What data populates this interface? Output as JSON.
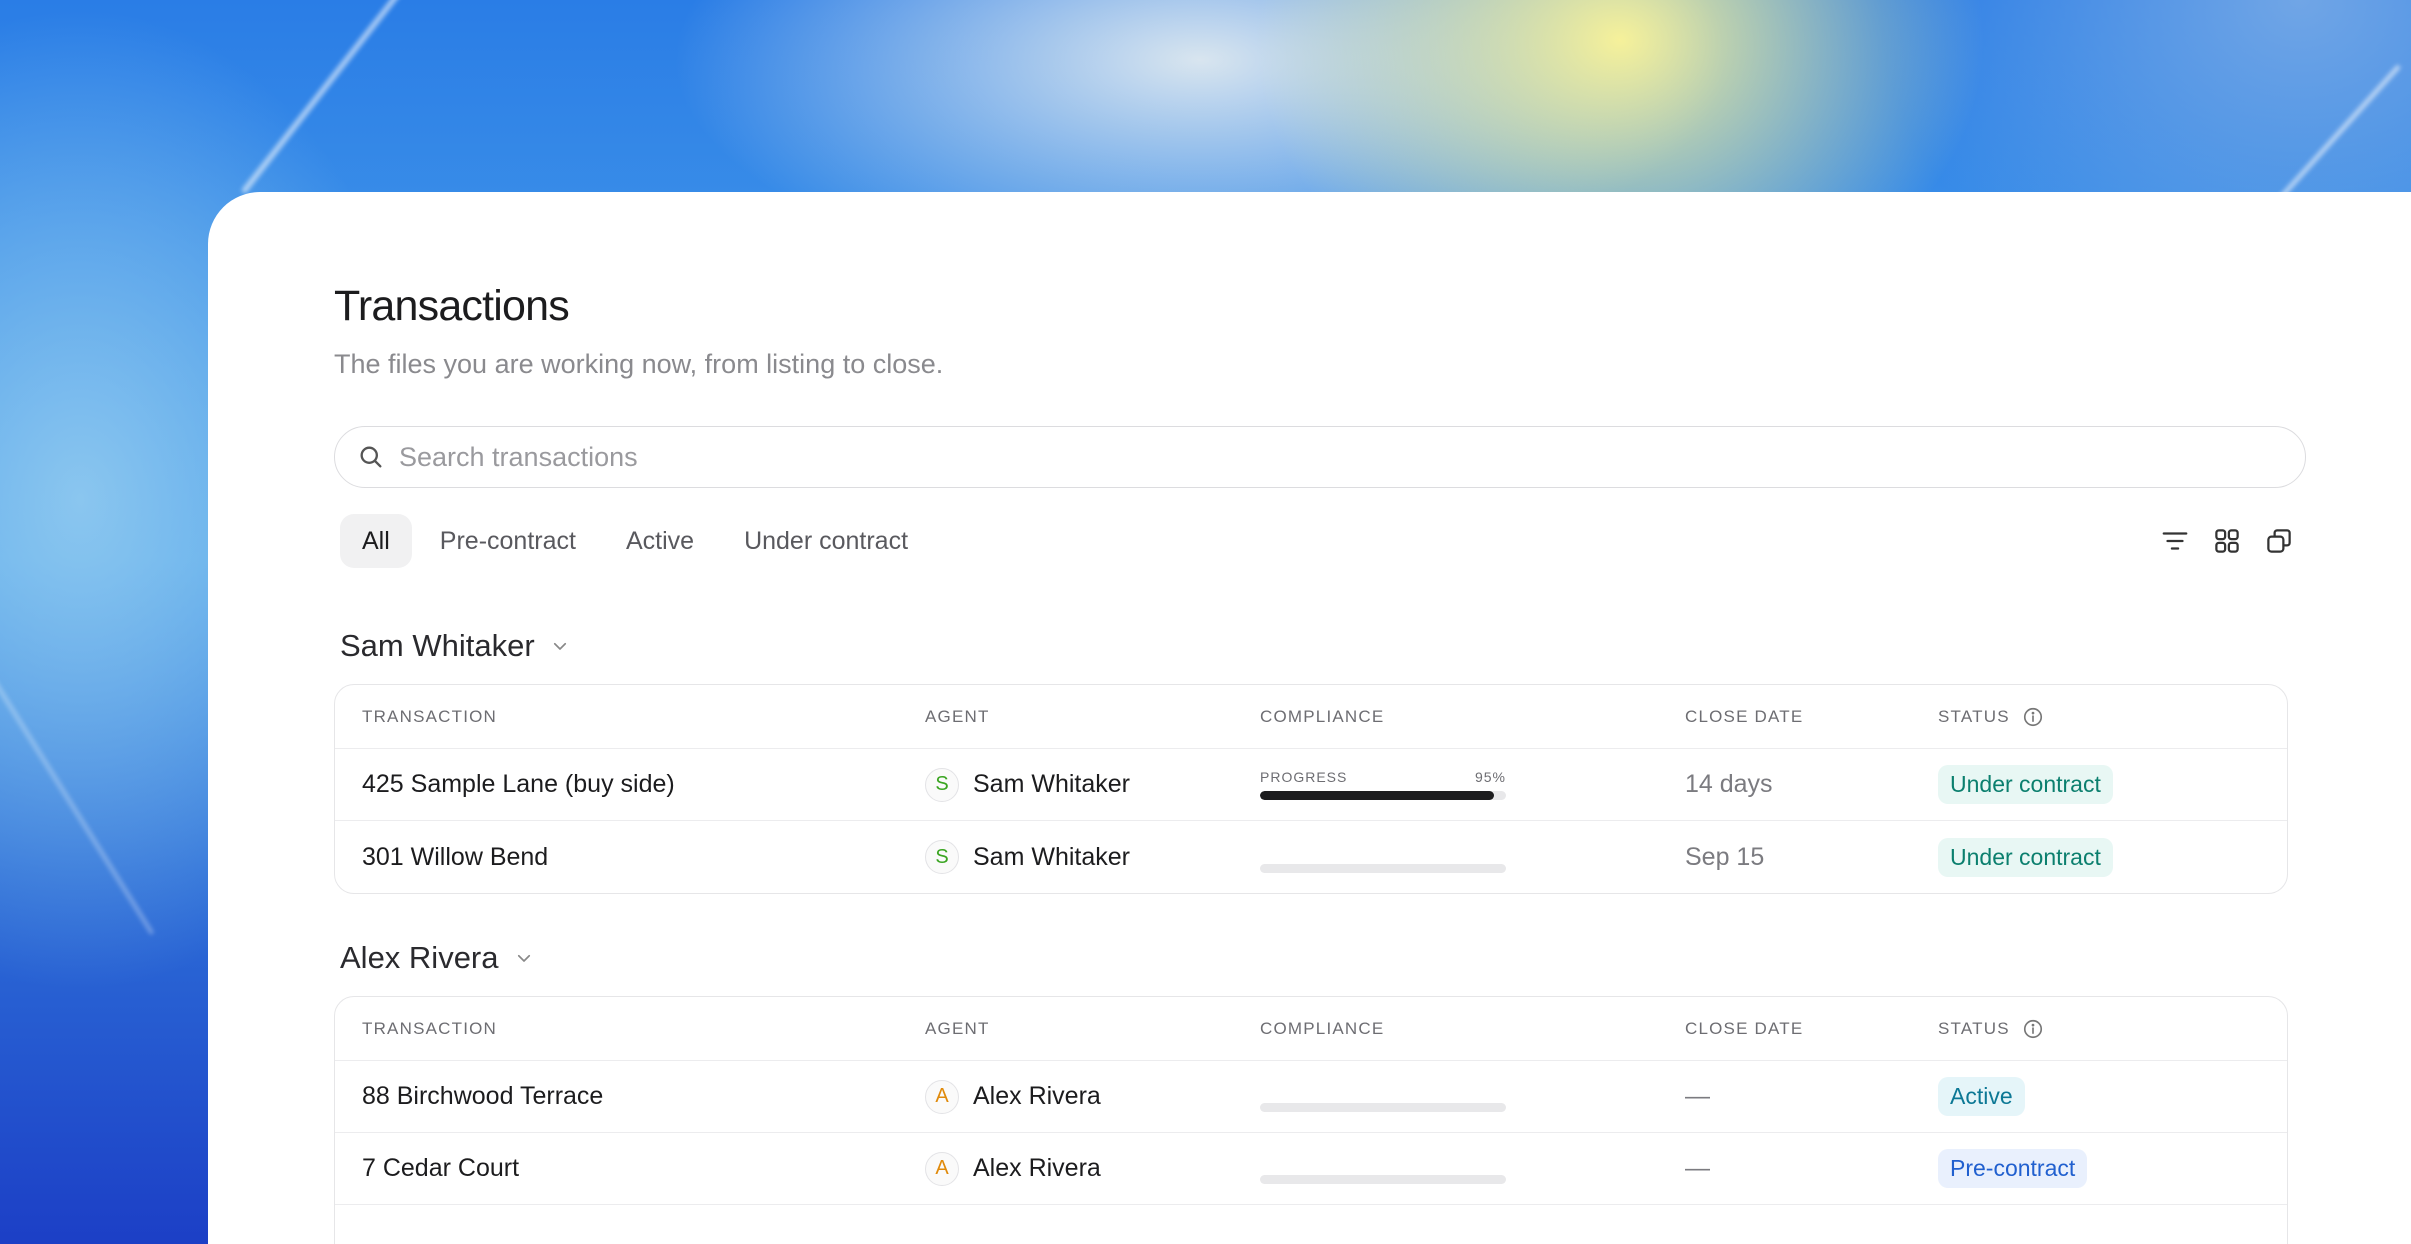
{
  "page": {
    "title": "Transactions",
    "subtitle": "The files you are working now, from listing to close."
  },
  "search": {
    "placeholder": "Search transactions",
    "value": ""
  },
  "tabs": [
    {
      "label": "All",
      "active": true
    },
    {
      "label": "Pre-contract",
      "active": false
    },
    {
      "label": "Active",
      "active": false
    },
    {
      "label": "Under contract",
      "active": false
    }
  ],
  "toolbar_icons": [
    "filter-lines-icon",
    "grid-view-icon",
    "duplicate-icon"
  ],
  "columns": {
    "transaction": "TRANSACTION",
    "agent": "AGENT",
    "compliance": "COMPLIANCE",
    "close_date": "CLOSE DATE",
    "status": "STATUS"
  },
  "groups": [
    {
      "name": "Sam Whitaker",
      "rows": [
        {
          "transaction": "425 Sample Lane (buy side)",
          "agent_initial": "S",
          "agent": "Sam Whitaker",
          "progress_label": "PROGRESS",
          "progress_text": "95%",
          "progress": 0.95,
          "close_date": "14 days",
          "status": "Under contract"
        },
        {
          "transaction": "301 Willow Bend",
          "agent_initial": "S",
          "agent": "Sam Whitaker",
          "progress": 0,
          "close_date": "Sep 15",
          "status": "Under contract"
        }
      ]
    },
    {
      "name": "Alex Rivera",
      "rows": [
        {
          "transaction": "88 Birchwood Terrace",
          "agent_initial": "A",
          "agent": "Alex Rivera",
          "progress": 0,
          "close_date": "—",
          "status": "Active"
        },
        {
          "transaction": "7 Cedar Court",
          "agent_initial": "A",
          "agent": "Alex Rivera",
          "progress": 0,
          "close_date": "—",
          "status": "Pre-contract"
        }
      ]
    }
  ],
  "colors": {
    "under_contract": "#0b7f6e",
    "active": "#0c7895",
    "pre_contract": "#2160cf",
    "agent_sam": "#3aa521",
    "agent_alex": "#e08a0b"
  }
}
